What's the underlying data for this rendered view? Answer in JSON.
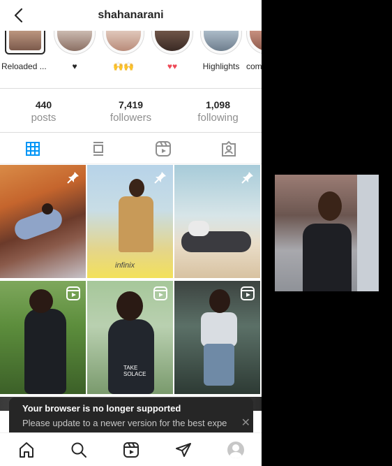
{
  "header": {
    "username": "shahanarani"
  },
  "highlights": [
    {
      "label": "Reloaded ..."
    },
    {
      "label": "♥"
    },
    {
      "label": "🙌🙌"
    },
    {
      "label": "♥♥"
    },
    {
      "label": "Highlights"
    },
    {
      "label": "com"
    }
  ],
  "stats": {
    "posts": {
      "value": "440",
      "label": "posts"
    },
    "followers": {
      "value": "7,419",
      "label": "followers"
    },
    "following": {
      "value": "1,098",
      "label": "following"
    }
  },
  "tabs": [
    "grid-icon",
    "feed-icon",
    "reels-icon",
    "tagged-icon"
  ],
  "grid": [
    {
      "badge": "pin-icon"
    },
    {
      "badge": "pin-icon",
      "text": "infinix"
    },
    {
      "badge": "pin-icon"
    },
    {
      "badge": "reel-icon"
    },
    {
      "badge": "reel-icon",
      "text": "TAKE SOLACE"
    },
    {
      "badge": "reel-icon"
    }
  ],
  "toast": {
    "title": "Your browser is no longer supported",
    "message": "Please update to a newer version for the best expe",
    "close": "✕"
  },
  "nav": [
    "home-icon",
    "search-icon",
    "reels-icon",
    "direct-icon",
    "profile-avatar"
  ],
  "colors": {
    "accent": "#0095f6",
    "text": "#262626",
    "muted": "#8e8e8e",
    "heart": "#ed4956"
  }
}
